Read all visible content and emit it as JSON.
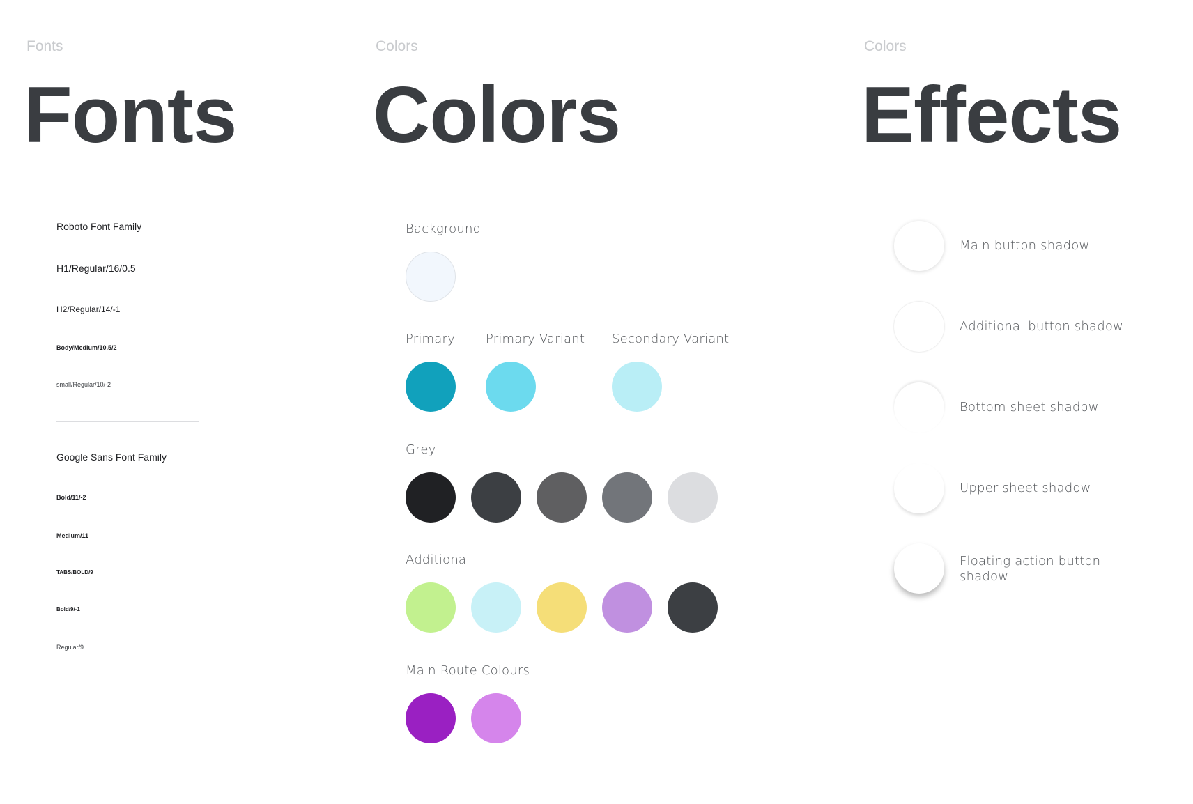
{
  "fonts": {
    "eyebrow": "Fonts",
    "title": "Fonts",
    "roboto_family": "Roboto Font Family",
    "roboto_styles": [
      "H1/Regular/16/0.5",
      "H2/Regular/14/-1",
      "Body/Medium/10.5/2",
      "small/Regular/10/-2"
    ],
    "google_family": "Google Sans Font Family",
    "google_styles": [
      "Bold/11/-2",
      "Medium/11",
      "TABS/BOLD/9",
      "Bold/9/-1",
      "Regular/9"
    ]
  },
  "colors": {
    "eyebrow": "Colors",
    "title": "Colors",
    "background": {
      "label": "Background",
      "swatches": [
        "#f2f7fd"
      ]
    },
    "primary": [
      {
        "label": "Primary",
        "color": "#11a1bc"
      },
      {
        "label": "Primary Variant",
        "color": "#6cdaee"
      },
      {
        "label": "Secondary Variant",
        "color": "#b9eef6"
      }
    ],
    "grey": {
      "label": "Grey",
      "swatches": [
        "#202124",
        "#3c3f43",
        "#5f5f61",
        "#72757a",
        "#dcdde0"
      ]
    },
    "additional": {
      "label": "Additional",
      "swatches": [
        "#c2f18f",
        "#c8f1f7",
        "#f5de78",
        "#c090e0",
        "#3c3f43"
      ]
    },
    "main_route": {
      "label": "Main Route Colours",
      "swatches": [
        "#9a20c2",
        "#d585eb"
      ]
    }
  },
  "effects": {
    "eyebrow": "Colors",
    "title": "Effects",
    "items": [
      {
        "label": "Main button shadow"
      },
      {
        "label": "Additional button shadow"
      },
      {
        "label": "Bottom sheet shadow"
      },
      {
        "label": "Upper sheet shadow"
      },
      {
        "label": "Floating action button shadow"
      }
    ]
  }
}
